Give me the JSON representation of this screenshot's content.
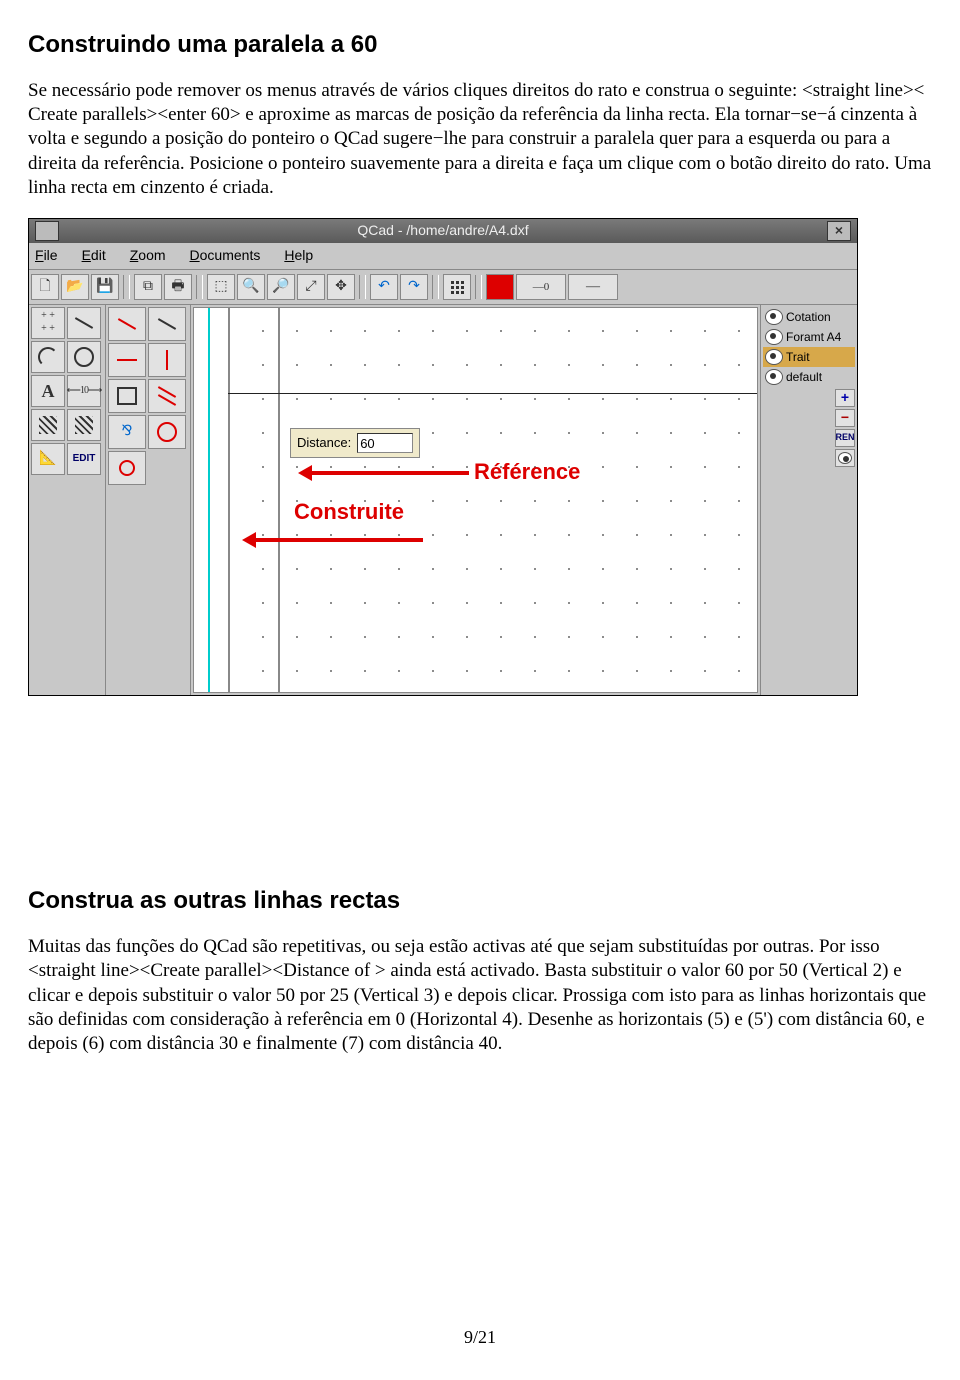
{
  "heading1": "Construindo uma paralela a 60",
  "para1": "Se necessário pode remover os menus através de vários cliques direitos do rato e construa o seguinte: <straight line>< Create parallels><enter 60> e aproxime as marcas de posição da referência da linha recta. Ela tornar−se−á cinzenta à volta e segundo a posição do ponteiro o QCad sugere−lhe para construir a paralela quer para a esquerda ou para a direita da referência. Posicione o ponteiro suavemente para a direita e faça um clique com o botão direito do rato. Uma linha recta em cinzento é criada.",
  "app": {
    "title": "QCad  -  /home/andre/A4.dxf",
    "menu": {
      "file": "File",
      "edit": "Edit",
      "zoom": "Zoom",
      "documents": "Documents",
      "help": "Help"
    },
    "distance_label": "Distance:",
    "distance_value": "60",
    "label_reference": "Référence",
    "label_construite": "Construite",
    "layers": [
      "Cotation",
      "Foramt A4",
      "Trait",
      "default"
    ],
    "edit_btn": "EDIT",
    "ren_btn": "REN",
    "line_weight": "0"
  },
  "heading2": "Construa as outras linhas rectas",
  "para2": "Muitas das funções do QCad são repetitivas, ou seja estão activas até que sejam substituídas por outras. Por isso <straight line><Create parallel><Distance of > ainda está activado. Basta substituir o valor 60 por 50 (Vertical 2) e clicar e depois substituir o valor 50 por 25 (Vertical 3) e depois clicar. Prossiga com isto para as linhas horizontais que são definidas com consideração à referência em 0 (Horizontal 4). Desenhe as horizontais (5) e (5') com distância 60, e depois (6) com distância 30 e finalmente (7) com distância 40.",
  "footer": "9/21"
}
